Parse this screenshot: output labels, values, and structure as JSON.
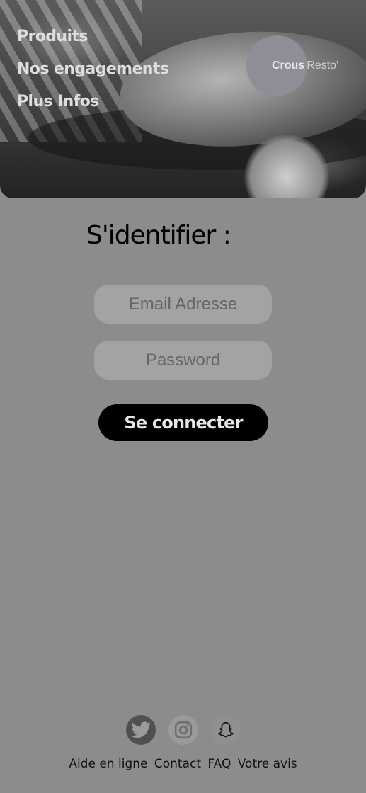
{
  "nav": {
    "items": [
      "Produits",
      "Nos engagements",
      "Plus Infos"
    ]
  },
  "logo": {
    "part1": "Crous",
    "part2": "Resto'"
  },
  "login": {
    "title": "S'identifier :",
    "email_placeholder": "Email Adresse",
    "password_placeholder": "Password",
    "submit_label": "Se connecter"
  },
  "social": {
    "icons": [
      "twitter-icon",
      "instagram-icon",
      "snapchat-icon"
    ]
  },
  "footer": {
    "links": [
      "Aide en ligne",
      "Contact",
      "FAQ",
      "Votre avis"
    ]
  },
  "colors": {
    "background": "#8c8c8c",
    "button": "#000000",
    "field": "#a3a3a3"
  }
}
